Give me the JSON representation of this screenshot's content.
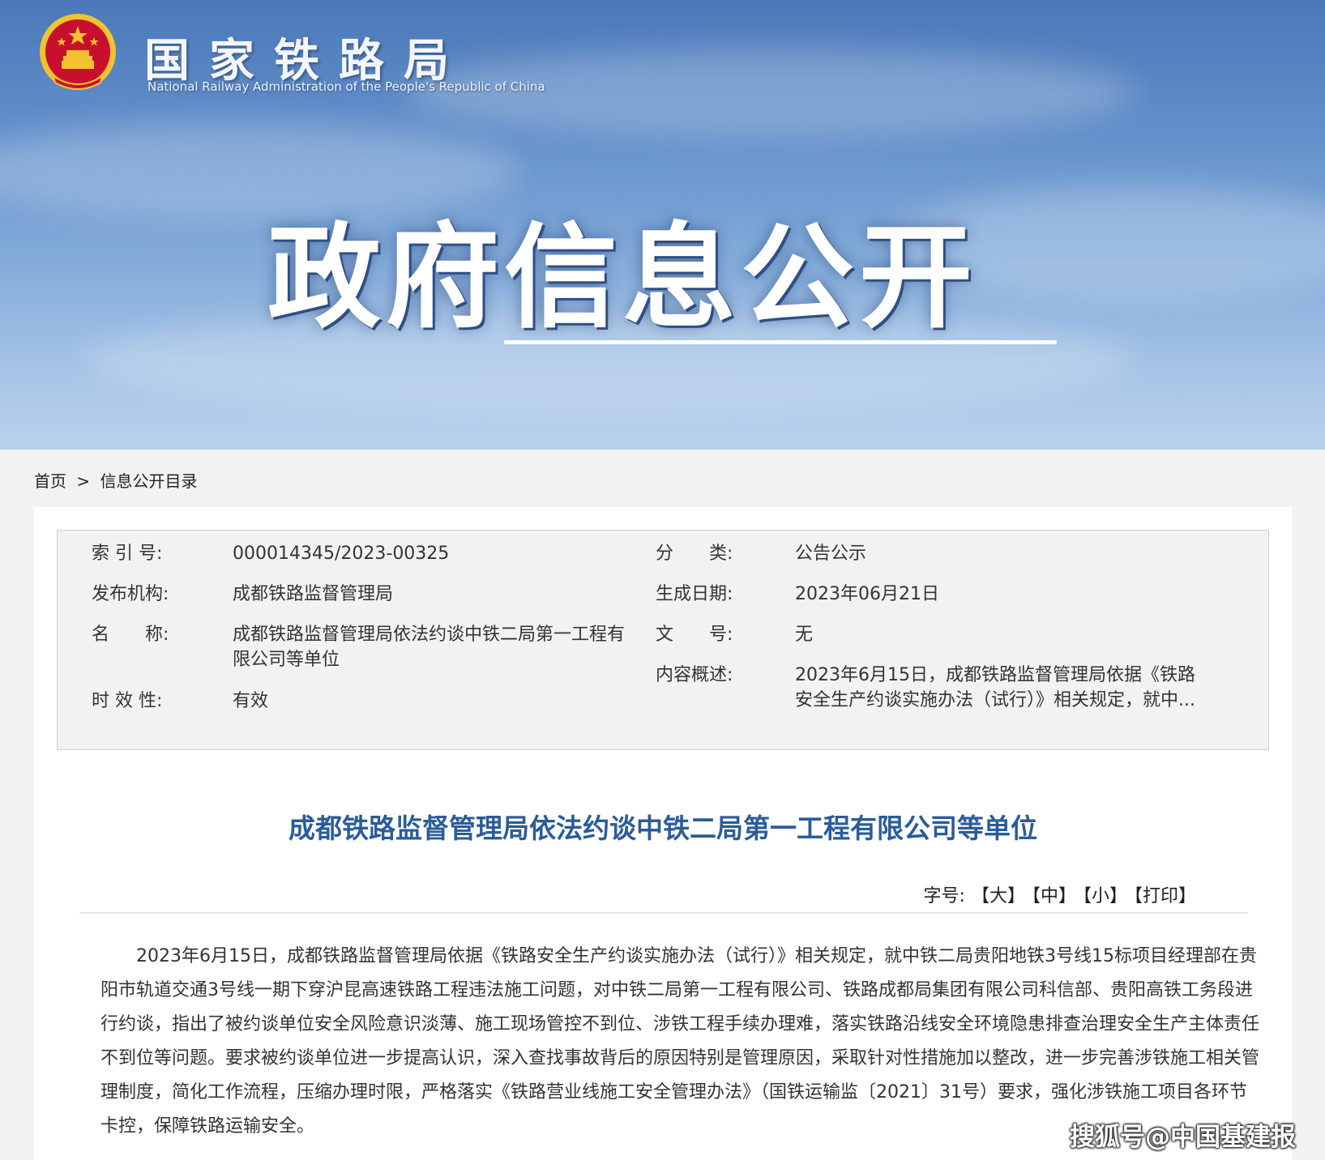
{
  "header": {
    "org_name_cn": "国家铁路局",
    "org_name_en": "National Railway Administration of the People's Republic of China",
    "banner_title": "政府信息公开"
  },
  "breadcrumb": {
    "home": "首页",
    "separator": ">",
    "current": "信息公开目录"
  },
  "meta": {
    "index_label": "索 引 号:",
    "index_value": "000014345/2023-00325",
    "category_label": "分　　类:",
    "category_value": "公告公示",
    "publisher_label": "发布机构:",
    "publisher_value": "成都铁路监督管理局",
    "date_label": "生成日期:",
    "date_value": "2023年06月21日",
    "name_label": "名　　称:",
    "name_value": "成都铁路监督管理局依法约谈中铁二局第一工程有限公司等单位",
    "docno_label": "文　　号:",
    "docno_value": "无",
    "summary_label": "内容概述:",
    "summary_value": "2023年6月15日，成都铁路监督管理局依据《铁路安全生产约谈实施办法（试行）》相关规定，就中...",
    "validity_label": "时 效 性:",
    "validity_value": "有效"
  },
  "article": {
    "title": "成都铁路监督管理局依法约谈中铁二局第一工程有限公司等单位",
    "font_size_label": "字号:",
    "font_large": "【大】",
    "font_medium": "【中】",
    "font_small": "【小】",
    "print": "【打印】",
    "body": "2023年6月15日，成都铁路监督管理局依据《铁路安全生产约谈实施办法（试行）》相关规定，就中铁二局贵阳地铁3号线15标项目经理部在贵阳市轨道交通3号线一期下穿沪昆高速铁路工程违法施工问题，对中铁二局第一工程有限公司、铁路成都局集团有限公司科信部、贵阳高铁工务段进行约谈，指出了被约谈单位安全风险意识淡薄、施工现场管控不到位、涉铁工程手续办理难，落实铁路沿线安全环境隐患排查治理安全生产主体责任不到位等问题。要求被约谈单位进一步提高认识，深入查找事故背后的原因特别是管理原因，采取针对性措施加以整改，进一步完善涉铁施工相关管理制度，简化工作流程，压缩办理时限，严格落实《铁路营业线施工安全管理办法》（国铁运输监〔2021〕31号）要求，强化涉铁施工项目各环节卡控，保障铁路运输安全。"
  },
  "watermark": "搜狐号@中国基建报",
  "colors": {
    "banner_top": "#4b78b8",
    "banner_bottom": "#b9d1ec",
    "title_blue": "#2b5c9a",
    "emblem_red": "#c8102e",
    "emblem_gold": "#f2c230"
  }
}
